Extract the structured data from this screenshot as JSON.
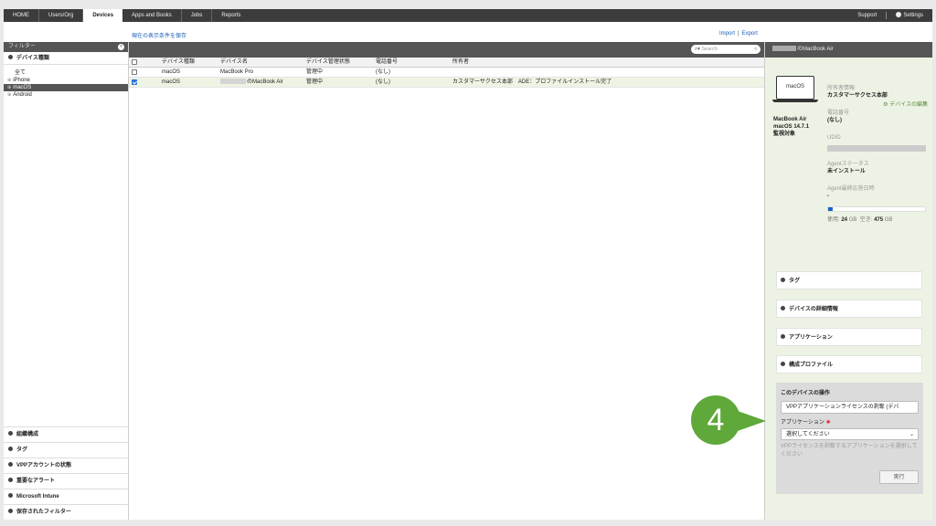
{
  "nav": {
    "items": [
      "HOME",
      "Users/Org",
      "Devices",
      "Apps and Books",
      "Jobs",
      "Reports"
    ],
    "support": "Support",
    "settings": "Settings"
  },
  "toolbar": {
    "save_filter": "現在の表示条件を保存",
    "import": "Import",
    "separator": "|",
    "export": "Export"
  },
  "sidebar": {
    "header": "フィルター",
    "device_type_section": "デバイス種類",
    "device_types": [
      "全て",
      "iPhone",
      "macOS",
      "Android"
    ],
    "selected_device_type": "macOS",
    "bottom_sections": [
      "組織構成",
      "タグ",
      "VPPアカウントの状態",
      "重要なアラート",
      "Microsoft Intune",
      "保存されたフィルター"
    ]
  },
  "table": {
    "search_placeholder": "Search",
    "columns": [
      "デバイス種類",
      "デバイス名",
      "デバイス管理状態",
      "電話番号",
      "所有者"
    ],
    "rows": [
      {
        "type": "macOS",
        "name": "MacBook Pro",
        "state": "管理中",
        "phone": "(なし)",
        "owner": "",
        "checked": false
      },
      {
        "type": "macOS",
        "name": "のMacBook Air",
        "state": "管理中",
        "phone": "(なし)",
        "owner": "カスタマーサクセス本部　ADE：プロファイルインストール完了",
        "checked": true
      }
    ]
  },
  "detail": {
    "header_title": "のMacBook Air",
    "device_label": "macOS",
    "model": "MacBook Air",
    "os": "macOS 14.7.1",
    "supervised": "監視対象",
    "owner_label": "所有者情報",
    "owner_value": "カスタマーサクセス本部",
    "edit_link": "デバイスの編集",
    "phone_label": "電話番号",
    "phone_value": "(なし)",
    "udid_label": "UDID",
    "agent_status_label": "Agentステータス",
    "agent_status_value": "未インストール",
    "agent_response_label": "Agent最終応答日時",
    "agent_response_value": "-",
    "disk_used_fraction": 0.048,
    "disk_used_label": "使用:",
    "disk_used_value": "24",
    "disk_free_label": "空き:",
    "disk_free_value": "475",
    "disk_unit": "GB",
    "accordions": [
      "タグ",
      "デバイスの詳細情報",
      "アプリケーション",
      "構成プロファイル"
    ],
    "operation": {
      "title": "このデバイスの操作",
      "action_value": "VPPアプリケーションライセンスの剥奪 (デバ",
      "app_label": "アプリケーション",
      "required_mark": "✱",
      "app_placeholder": "選択してください",
      "hint": "VPPライセンスを剥奪するアプリケーションを選択してください",
      "run_button": "実行"
    }
  },
  "step_badge": "4",
  "colors": {
    "accent_green": "#5fa83a",
    "selected_row": "#eef4e3",
    "link": "#1a5fb4"
  }
}
